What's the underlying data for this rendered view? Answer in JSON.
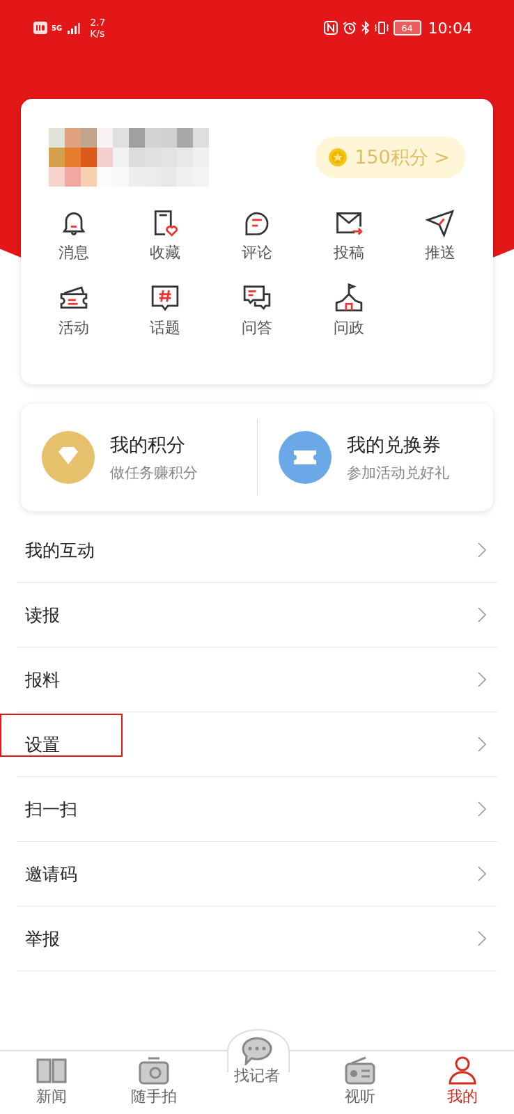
{
  "status_bar": {
    "speed": "2.7",
    "speed_unit": "K/s",
    "network": "5G",
    "battery": "64",
    "time": "10:04"
  },
  "profile": {
    "points_badge": "150积分 >"
  },
  "shortcuts": [
    {
      "label": "消息"
    },
    {
      "label": "收藏"
    },
    {
      "label": "评论"
    },
    {
      "label": "投稿"
    },
    {
      "label": "推送"
    },
    {
      "label": "活动"
    },
    {
      "label": "话题"
    },
    {
      "label": "问答"
    },
    {
      "label": "问政"
    }
  ],
  "rewards": [
    {
      "title": "我的积分",
      "subtitle": "做任务赚积分",
      "color": "#e6c06a"
    },
    {
      "title": "我的兑换券",
      "subtitle": "参加活动兑好礼",
      "color": "#6aa8e8"
    }
  ],
  "menu": [
    {
      "label": "我的互动",
      "highlighted": false
    },
    {
      "label": "读报",
      "highlighted": false
    },
    {
      "label": "报料",
      "highlighted": false
    },
    {
      "label": "设置",
      "highlighted": true
    },
    {
      "label": "扫一扫",
      "highlighted": false
    },
    {
      "label": "邀请码",
      "highlighted": false
    },
    {
      "label": "举报",
      "highlighted": false
    }
  ],
  "tab_bar": [
    {
      "label": "新闻",
      "selected": false
    },
    {
      "label": "随手拍",
      "selected": false
    },
    {
      "label": "找记者",
      "selected": false
    },
    {
      "label": "视听",
      "selected": false
    },
    {
      "label": "我的",
      "selected": true
    }
  ]
}
